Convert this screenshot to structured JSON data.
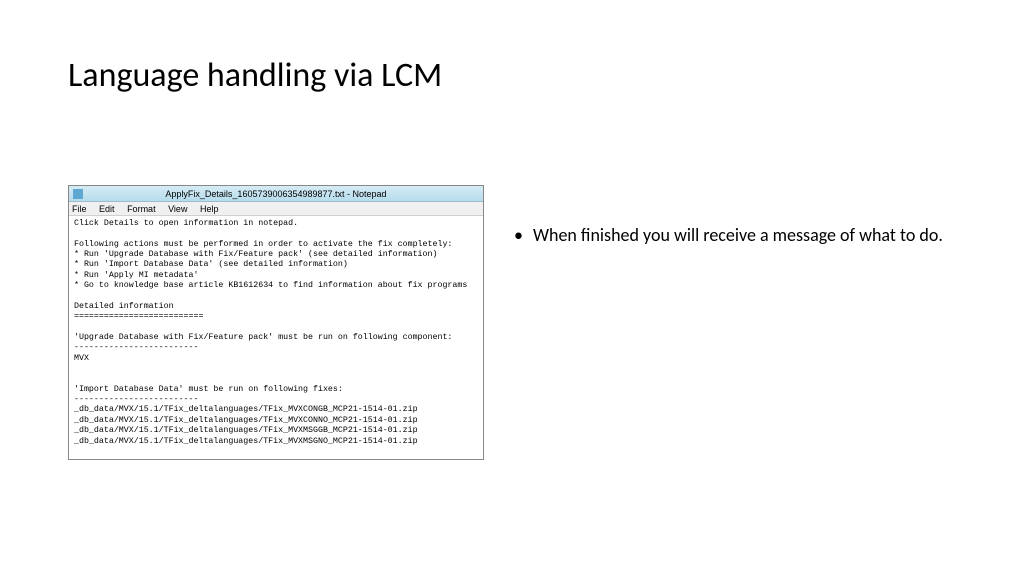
{
  "slide": {
    "title": "Language handling via LCM"
  },
  "bullet": {
    "text": "When finished you will receive a message of what to do."
  },
  "notepad": {
    "titlebar": "ApplyFix_Details_1605739006354989877.txt - Notepad",
    "menu": {
      "file": "File",
      "edit": "Edit",
      "format": "Format",
      "view": "View",
      "help": "Help"
    },
    "content": "Click Details to open information in notepad.\n\nFollowing actions must be performed in order to activate the fix completely:\n* Run 'Upgrade Database with Fix/Feature pack' (see detailed information)\n* Run 'Import Database Data' (see detailed information)\n* Run 'Apply MI metadata'\n* Go to knowledge base article KB1612634 to find information about fix programs\n\nDetailed information\n==========================\n\n'Upgrade Database with Fix/Feature pack' must be run on following component:\n-------------------------\nMVX\n\n\n'Import Database Data' must be run on following fixes:\n-------------------------\n_db_data/MVX/15.1/TFix_deltalanguages/TFix_MVXCONGB_MCP21-1514-01.zip\n_db_data/MVX/15.1/TFix_deltalanguages/TFix_MVXCONNO_MCP21-1514-01.zip\n_db_data/MVX/15.1/TFix_deltalanguages/TFix_MVXMSGGB_MCP21-1514-01.zip\n_db_data/MVX/15.1/TFix_deltalanguages/TFix_MVXMSGNO_MCP21-1514-01.zip"
  }
}
